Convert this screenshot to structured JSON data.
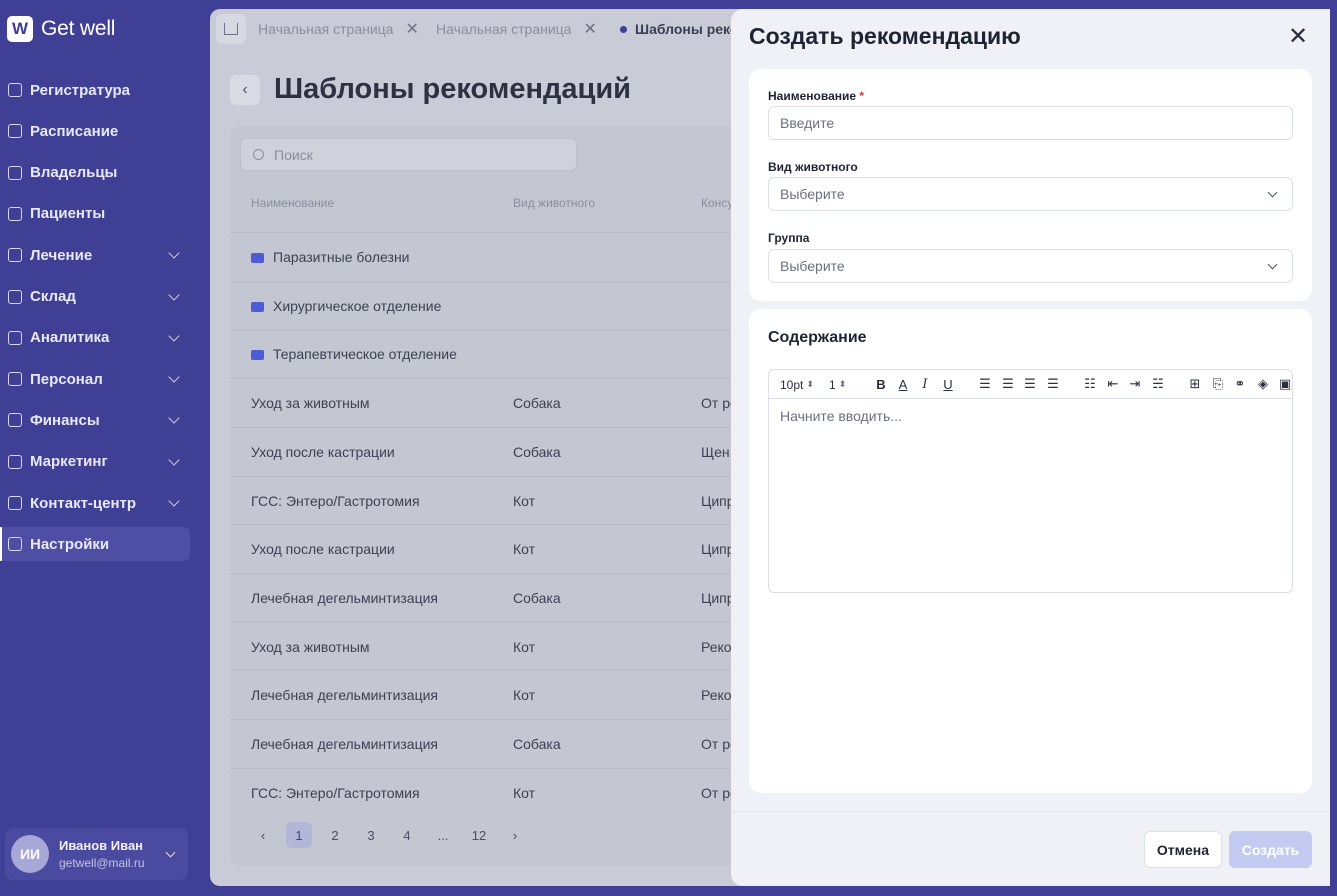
{
  "brand": {
    "logo_mark": "W",
    "name": "Get well"
  },
  "sidebar": {
    "items": [
      {
        "label": "Регистратура",
        "icon": "registry-icon",
        "expandable": false
      },
      {
        "label": "Расписание",
        "icon": "calendar-icon",
        "expandable": false
      },
      {
        "label": "Владельцы",
        "icon": "owners-icon",
        "expandable": false
      },
      {
        "label": "Пациенты",
        "icon": "paw-icon",
        "expandable": false
      },
      {
        "label": "Лечение",
        "icon": "medical-plus-icon",
        "expandable": true
      },
      {
        "label": "Склад",
        "icon": "box-icon",
        "expandable": true
      },
      {
        "label": "Аналитика",
        "icon": "chart-icon",
        "expandable": true
      },
      {
        "label": "Персонал",
        "icon": "person-icon",
        "expandable": true
      },
      {
        "label": "Финансы",
        "icon": "coins-icon",
        "expandable": true
      },
      {
        "label": "Маркетинг",
        "icon": "megaphone-icon",
        "expandable": true
      },
      {
        "label": "Контакт-центр",
        "icon": "chat-icon",
        "expandable": true
      },
      {
        "label": "Настройки",
        "icon": "gear-icon",
        "expandable": false,
        "active": true
      }
    ]
  },
  "user": {
    "initials": "ИИ",
    "name": "Иванов Иван",
    "email": "getwell@mail.ru"
  },
  "tabs": [
    {
      "label": "Начальная страница"
    },
    {
      "label": "Начальная страница"
    },
    {
      "label": "Шаблоны реком"
    }
  ],
  "page": {
    "title": "Шаблоны рекомендаций",
    "search_placeholder": "Поиск",
    "columns": [
      "Наименование",
      "Вид животного",
      "Консу"
    ],
    "folders": [
      "Паразитные болезни",
      "Хирургическое отделение",
      "Терапевтическое отделение"
    ],
    "rows": [
      {
        "name": "Уход за животным",
        "animal": "Собака",
        "extra": "От ро"
      },
      {
        "name": "Уход после кастрации",
        "animal": "Собака",
        "extra": "Щен"
      },
      {
        "name": "ГСС: Энтеро/Гастротомия",
        "animal": "Кот",
        "extra": "Ципр"
      },
      {
        "name": "Уход после кастрации",
        "animal": "Кот",
        "extra": "Ципр"
      },
      {
        "name": "Лечебная дегельминтизация",
        "animal": "Собака",
        "extra": "Ципр"
      },
      {
        "name": "Уход за животным",
        "animal": "Кот",
        "extra": "Реко"
      },
      {
        "name": "Лечебная дегельминтизация",
        "animal": "Кот",
        "extra": "Реко"
      },
      {
        "name": "Лечебная дегельминтизация",
        "animal": "Собака",
        "extra": "От ро"
      },
      {
        "name": "ГСС: Энтеро/Гастротомия",
        "animal": "Кот",
        "extra": "От ро"
      }
    ],
    "pagination": [
      "1",
      "2",
      "3",
      "4",
      "...",
      "12"
    ],
    "current_page": "1"
  },
  "drawer": {
    "title": "Создать рекомендацию",
    "fields": {
      "name": {
        "label": "Наименование",
        "required_mark": "*",
        "placeholder": "Введите",
        "value": ""
      },
      "animal": {
        "label": "Вид животного",
        "placeholder": "Выберите"
      },
      "group": {
        "label": "Группа",
        "placeholder": "Выберите"
      }
    },
    "content": {
      "title": "Содержание",
      "font_size": "10pt",
      "line_height": "1",
      "placeholder": "Начните вводить..."
    },
    "buttons": {
      "cancel": "Отмена",
      "create": "Создать"
    }
  },
  "colors": {
    "brand": "#3f3f96",
    "primary_disabled": "#c3cbf0",
    "required": "#e3342f"
  }
}
